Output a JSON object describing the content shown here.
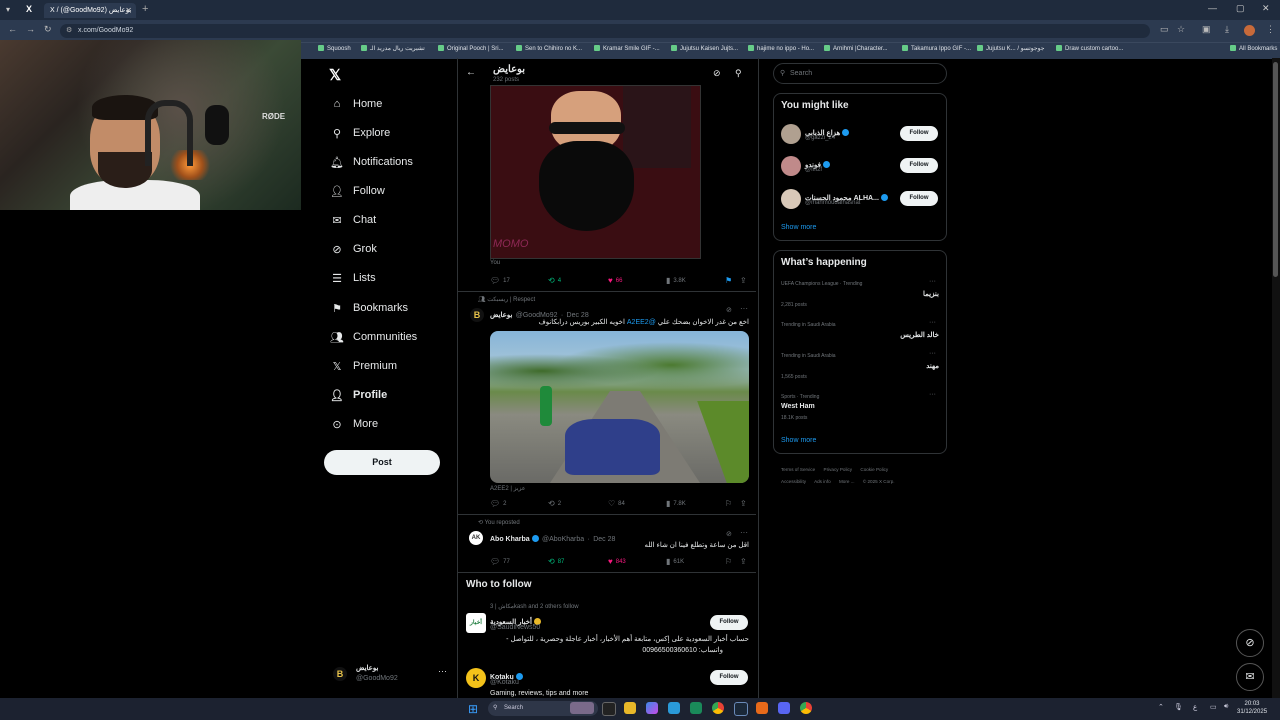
{
  "browser": {
    "tab_title": "X / (@GoodMo92) بوعايض",
    "url": "x.com/GoodMo92",
    "bookmarks": [
      "Squoosh",
      "تشيريت ريال مدريد الـ",
      "Original Pooch | Sri...",
      "Sen to Chihiro no K...",
      "Kramar Smile GIF -...",
      "Jujutsu Kaisen Jujts...",
      "hajime no ippo - Ho...",
      "Arnihmi |Character...",
      "Takamura Ippo GIF -...",
      "Jujutsu K... / جوجوتسو",
      "Draw custom cartoo..."
    ],
    "all_bookmarks": "All Bookmarks"
  },
  "webcam": {
    "mic_brand": "RØDE"
  },
  "nav": {
    "items": [
      {
        "label": "Home",
        "icon": "home-icon"
      },
      {
        "label": "Explore",
        "icon": "search-icon"
      },
      {
        "label": "Notifications",
        "icon": "bell-icon"
      },
      {
        "label": "Follow",
        "icon": "person-add-icon"
      },
      {
        "label": "Chat",
        "icon": "mail-icon"
      },
      {
        "label": "Grok",
        "icon": "grok-icon"
      },
      {
        "label": "Lists",
        "icon": "list-icon"
      },
      {
        "label": "Bookmarks",
        "icon": "bookmark-icon"
      },
      {
        "label": "Communities",
        "icon": "communities-icon"
      },
      {
        "label": "Premium",
        "icon": "x-icon"
      },
      {
        "label": "Profile",
        "icon": "person-icon"
      },
      {
        "label": "More",
        "icon": "more-circle-icon"
      }
    ],
    "post_button": "Post",
    "account": {
      "name": "بوعايض",
      "handle": "@GoodMo92"
    }
  },
  "header": {
    "name": "بوعايض",
    "posts_count": "232 posts"
  },
  "tweets": [
    {
      "image_text": "MOMO",
      "caption": "You",
      "replies": "17",
      "reposts": "4",
      "likes": "66",
      "views": "3.8K"
    },
    {
      "repost_label": "ريسبكت | Respect",
      "name": "بوعايض",
      "handle": "@GoodMo92",
      "date": "Dec 28",
      "text_main": "اخع من غدر الاخوان بضحك علي",
      "mention": "@A2EE2",
      "text_rest": "اخويه الكبير بوريس درابكانوف",
      "caption": "A2EE2 | عزيز",
      "replies": "2",
      "reposts": "2",
      "likes": "84",
      "views": "7.8K"
    },
    {
      "repost_label": "You reposted",
      "name": "Abo Kharba",
      "handle": "@AboKharba",
      "date": "Dec 28",
      "text": "اقل من ساعة وتطلع فينا ان شاء الله",
      "replies": "77",
      "reposts": "87",
      "likes": "843",
      "views": "61K"
    }
  ],
  "who_to_follow": {
    "title": "Who to follow",
    "items": [
      {
        "followed_by": "3 | مكاشkash and 2 others follow",
        "name": "أخبار السعودية",
        "handle": "@SaudiNews50",
        "bio1": "حساب أخبار السعودية على إكس، متابعة أهم الأخبار، أخبار عاجلة وحصرية ، للتواصل -",
        "bio2": "واتساب: 00966500360610",
        "logo": "أخبار",
        "button": "Follow"
      },
      {
        "name": "Kotaku",
        "handle": "@Kotaku",
        "bio1": "Gaming, reviews, tips and more",
        "logo": "K",
        "button": "Follow"
      }
    ]
  },
  "right": {
    "search_placeholder": "Search",
    "might_like": {
      "title": "You might like",
      "items": [
        {
          "name": "هزاع الذيابي",
          "handle": "@gazzi_24",
          "button": "Follow"
        },
        {
          "name": "فوندو",
          "handle": "@fifi2f",
          "button": "Follow"
        },
        {
          "name": "محمود الحسنات ALHA...",
          "handle": "@mahmoudalhasnat",
          "button": "Follow"
        }
      ],
      "show_more": "Show more"
    },
    "happening": {
      "title": "What’s happening",
      "items": [
        {
          "category": "UEFA Champions League · Trending",
          "name": "بنزيما",
          "count": "2,281 posts"
        },
        {
          "category": "Trending in Saudi Arabia",
          "name": "خالد الطريس",
          "count": ""
        },
        {
          "category": "Trending in Saudi Arabia",
          "name": "مهند",
          "count": "1,565 posts"
        },
        {
          "category": "Sports · Trending",
          "name": "West Ham",
          "count": "18.1K posts"
        }
      ],
      "show_more": "Show more"
    },
    "footer": [
      "Terms of Service",
      "Privacy Policy",
      "Cookie Policy",
      "Accessibility",
      "Ads info",
      "More ...",
      "© 2025 X Corp."
    ]
  },
  "taskbar": {
    "search_placeholder": "Search",
    "time": "20:03",
    "date": "31/12/2025"
  }
}
